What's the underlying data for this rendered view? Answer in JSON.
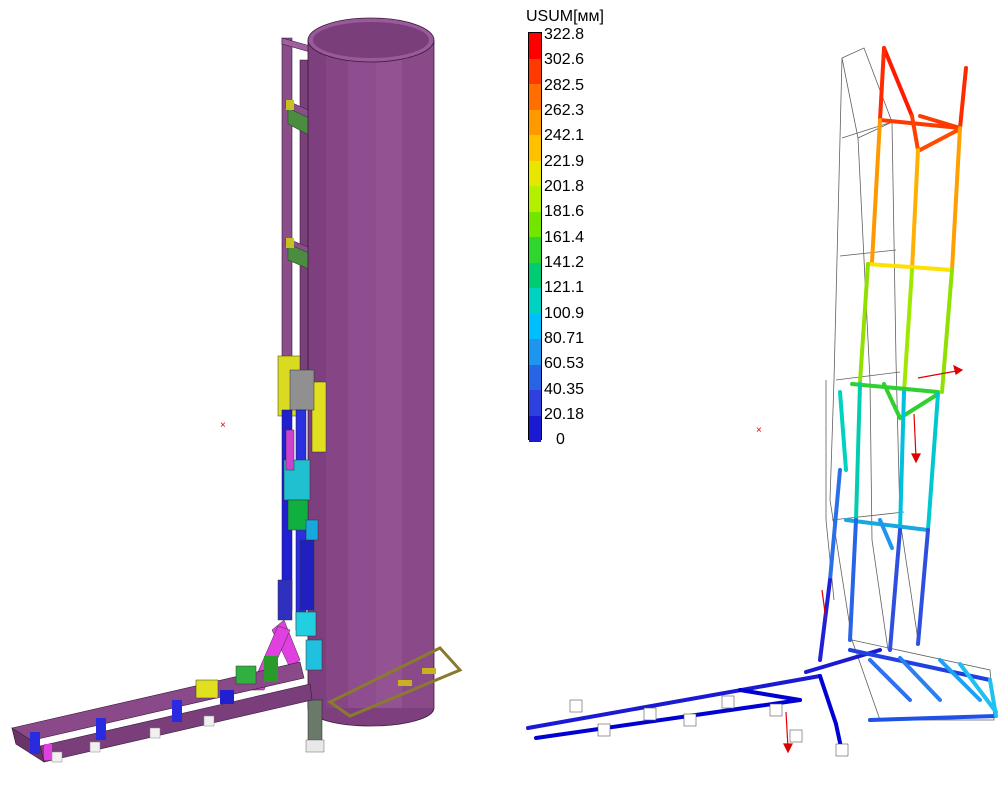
{
  "legend": {
    "title": "USUM[мм]",
    "labels": [
      "322.8",
      "302.6",
      "282.5",
      "262.3",
      "242.1",
      "221.9",
      "201.8",
      "181.6",
      "161.4",
      "141.2",
      "121.1",
      "100.9",
      "80.71",
      "60.53",
      "40.35",
      "20.18",
      "0"
    ],
    "colors": [
      "#ff0000",
      "#ff3a00",
      "#ff6e00",
      "#ff9900",
      "#ffc000",
      "#e6e600",
      "#b3f000",
      "#73e600",
      "#2ed62e",
      "#00cc73",
      "#00d2c2",
      "#00bfff",
      "#1e96f0",
      "#2864e6",
      "#2e40e0",
      "#1a1ad2",
      "#0000d2"
    ]
  },
  "model_left": {
    "tank_color": "#8b4a8b",
    "origin_symbol": "×"
  },
  "model_right": {
    "origin_symbol": "×"
  }
}
